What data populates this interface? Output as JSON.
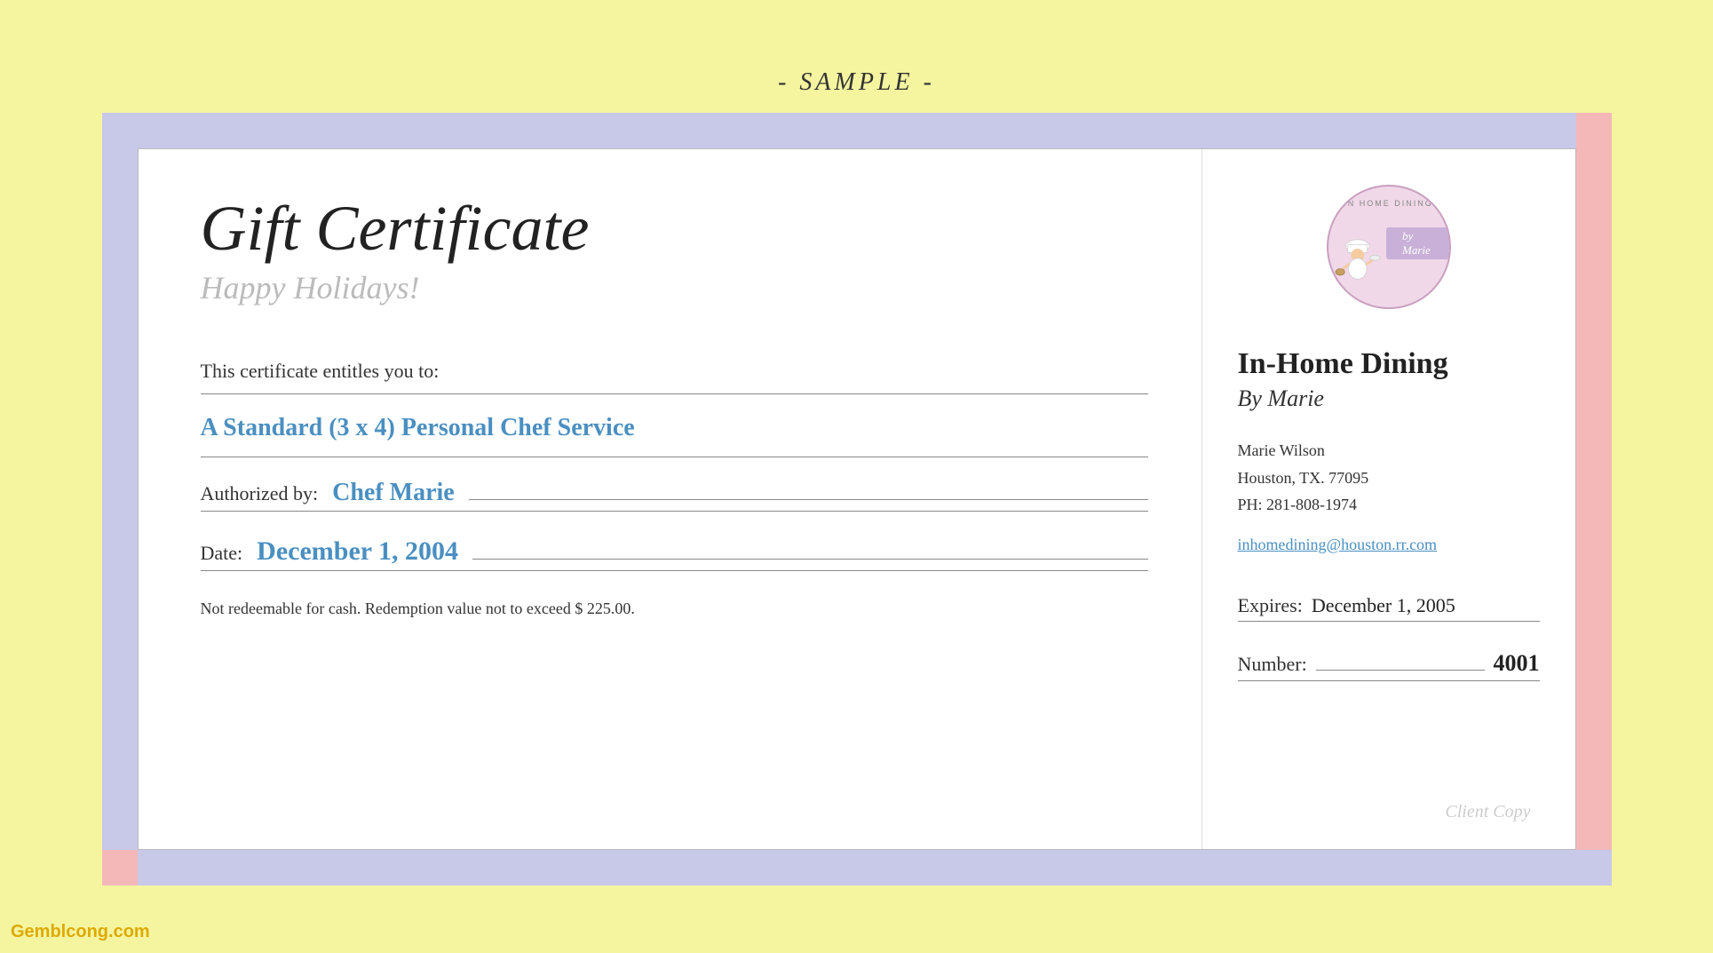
{
  "page": {
    "background_color": "#f5f5a0",
    "sample_label": "- SAMPLE -"
  },
  "certificate": {
    "title": "Gift Certificate",
    "subtitle": "Happy Holidays!",
    "entitles_text": "This certificate entitles you to:",
    "service": "A Standard (3 x 4) Personal Chef Service",
    "authorized_by_label": "Authorized by:",
    "authorized_by_value": "Chef Marie",
    "date_label": "Date:",
    "date_value": "December 1, 2004",
    "disclaimer": "Not redeemable for cash. Redemption value not to exceed $ 225.00.",
    "watermark": "Client Copy"
  },
  "company": {
    "name": "In-Home Dining",
    "subtitle": "By Marie",
    "logo_top_text": "IN HOME DINING",
    "logo_by": "by Marie",
    "contact": {
      "name": "Marie Wilson",
      "address": "Houston, TX.  77095",
      "phone": "PH: 281-808-1974",
      "email": "inhomedining@houston.rr.com"
    },
    "expires_label": "Expires:",
    "expires_value": "December 1, 2005",
    "number_label": "Number:",
    "number_value": "4001"
  },
  "footer": {
    "site": "Gemblcong.com"
  }
}
